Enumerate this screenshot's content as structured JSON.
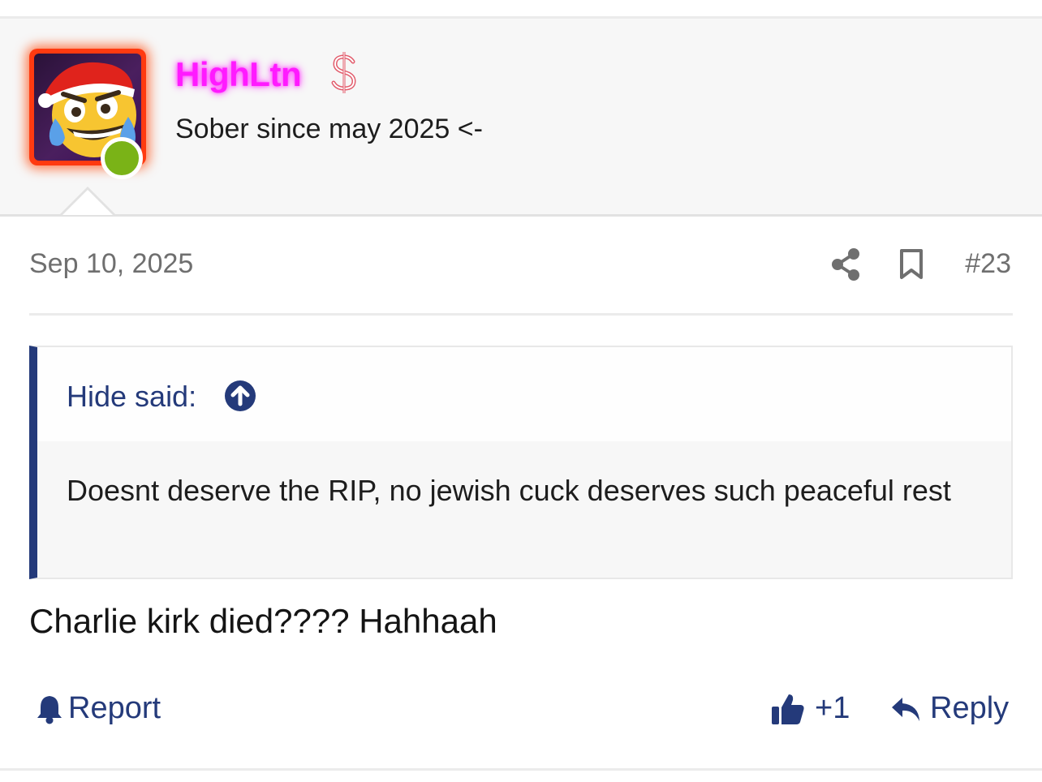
{
  "user": {
    "username": "HighLtn",
    "title": "Sober since may 2025 <-",
    "status": "online",
    "avatar_icon": "santa-hat-laughing-crying-emoji",
    "badge_icon": "dollar-icon"
  },
  "post": {
    "date": "Sep 10, 2025",
    "number": "#23",
    "message": "Charlie kirk died???? Hahhaah"
  },
  "quote": {
    "author": "Hide said:",
    "text": "Doesnt deserve the RIP, no jewish cuck deserves such peaceful rest"
  },
  "actions": {
    "report_label": "Report",
    "like_count": "+1",
    "reply_label": "Reply"
  },
  "colors": {
    "accent": "#243a7a",
    "username": "#ff1aff",
    "online": "#7ab317",
    "avatar_border": "#ff3a10",
    "muted_text": "#6f6f6f"
  }
}
